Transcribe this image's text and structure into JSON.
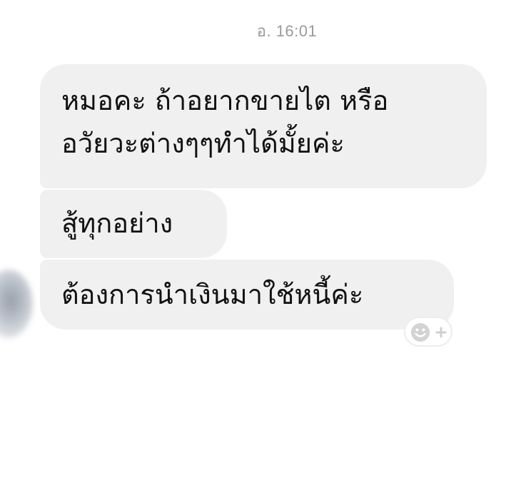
{
  "conversation": {
    "timestamp": "อ. 16:01",
    "messages": [
      {
        "lines": [
          "หมอคะ ถ้าอยากขายไต หรือ",
          "อวัยวะต่างๆๆทำได้มั้ยค่ะ"
        ]
      },
      {
        "lines": [
          "สู้ทุกอย่าง"
        ]
      },
      {
        "lines": [
          "ต้องการนำเงินมาใช้หนี้ค่ะ"
        ]
      }
    ],
    "reaction_icon": "add-reaction-smiley-icon",
    "colors": {
      "bubble": "#f0f0f0",
      "text": "#111111",
      "timestamp": "#9a9a9a",
      "icon": "#cfcfcf"
    }
  }
}
